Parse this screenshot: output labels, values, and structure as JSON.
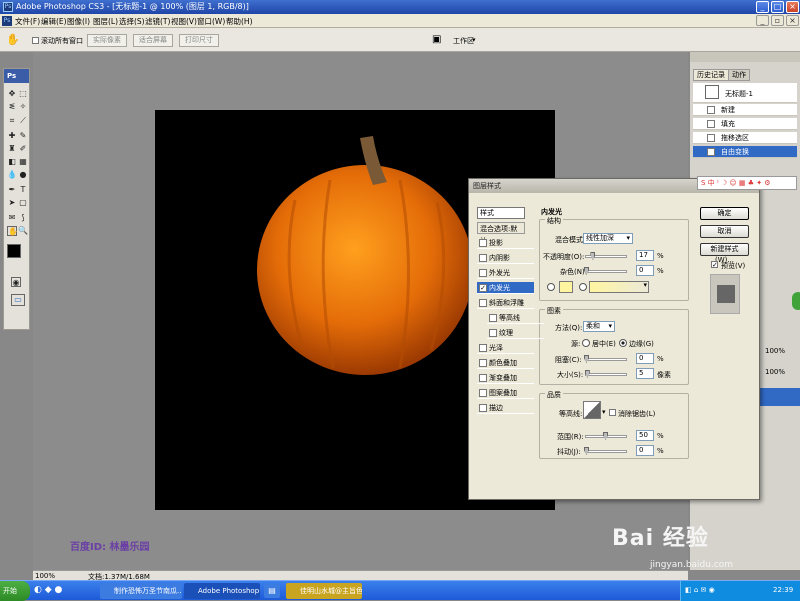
{
  "window": {
    "title": "Adobe Photoshop CS3 - [无标题-1 @ 100% (图层 1, RGB/8)]",
    "ps_icon": "Ps"
  },
  "menu": [
    "文件(F)",
    "编辑(E)",
    "图像(I)",
    "图层(L)",
    "选择(S)",
    "滤镜(T)",
    "视图(V)",
    "窗口(W)",
    "帮助(H)"
  ],
  "options": {
    "scroll_all": "滚动所有窗口",
    "actual_pixels": "实际像素",
    "fit_screen": "适合屏幕",
    "print_size": "打印尺寸",
    "workspace": "工作区"
  },
  "toolbox": {
    "header": "Ps"
  },
  "history_panel": {
    "tabs": [
      "历史记录",
      "动作"
    ],
    "snapshot": "无标题-1",
    "items": [
      {
        "label": "新建",
        "active": false
      },
      {
        "label": "填充",
        "active": false
      },
      {
        "label": "拖移选区",
        "active": false
      },
      {
        "label": "自由变换",
        "active": true
      }
    ]
  },
  "layers_panel": {
    "pct1": "100%",
    "pct2": "100%"
  },
  "dialog": {
    "title": "图层样式",
    "styles_header": "样式",
    "blend_options": "混合选项:默认",
    "styles": [
      {
        "label": "投影",
        "checked": false
      },
      {
        "label": "内阴影",
        "checked": false
      },
      {
        "label": "外发光",
        "checked": false
      },
      {
        "label": "内发光",
        "checked": true
      },
      {
        "label": "斜面和浮雕",
        "checked": false
      },
      {
        "label": "等高线",
        "checked": false
      },
      {
        "label": "纹理",
        "checked": false
      },
      {
        "label": "光泽",
        "checked": false
      },
      {
        "label": "颜色叠加",
        "checked": false
      },
      {
        "label": "渐变叠加",
        "checked": false
      },
      {
        "label": "图案叠加",
        "checked": false
      },
      {
        "label": "描边",
        "checked": false
      }
    ],
    "section": "内发光",
    "structure": {
      "legend": "结构",
      "blend_mode_label": "混合模式:",
      "blend_mode_value": "线性加深",
      "opacity_label": "不透明度(O):",
      "opacity_value": "17",
      "opacity": 0.17,
      "noise_label": "杂色(N):",
      "noise_value": "0",
      "noise": 0.0,
      "pct": "%",
      "glow_color": "#fff5a0"
    },
    "elements": {
      "legend": "图素",
      "technique_label": "方法(Q):",
      "technique_value": "柔和",
      "source_label": "源:",
      "center_label": "居中(E)",
      "edge_label": "边缘(G)",
      "choke_label": "阻塞(C):",
      "choke_value": "0",
      "choke": 0.0,
      "size_label": "大小(S):",
      "size_value": "5",
      "size": 0.02,
      "px": "像素"
    },
    "quality": {
      "legend": "品质",
      "contour_label": "等高线:",
      "antialias_label": "消除锯齿(L)",
      "range_label": "范围(R):",
      "range_value": "50",
      "range": 0.5,
      "jitter_label": "抖动(J):",
      "jitter_value": "0",
      "jitter": 0.0
    },
    "buttons": {
      "ok": "确定",
      "cancel": "取消",
      "new_style": "新建样式(W)...",
      "preview": "预览(V)"
    }
  },
  "status": {
    "zoom": "100%",
    "doc": "文档:1.37M/1.68M"
  },
  "watermark": {
    "label": "百度ID: 林墨乐园",
    "logo": "Bai 经验",
    "url": "jingyan.baidu.com"
  },
  "taskbar": {
    "start": "开始",
    "tasks": [
      "制作恐怖万圣节南瓜...",
      "Adobe Photoshop ...",
      "佳明山水城@主旨色..."
    ],
    "time": "22:39"
  },
  "colors": {
    "accent": "#316ac5",
    "fg": "#000000",
    "bg": "#ffffff"
  }
}
